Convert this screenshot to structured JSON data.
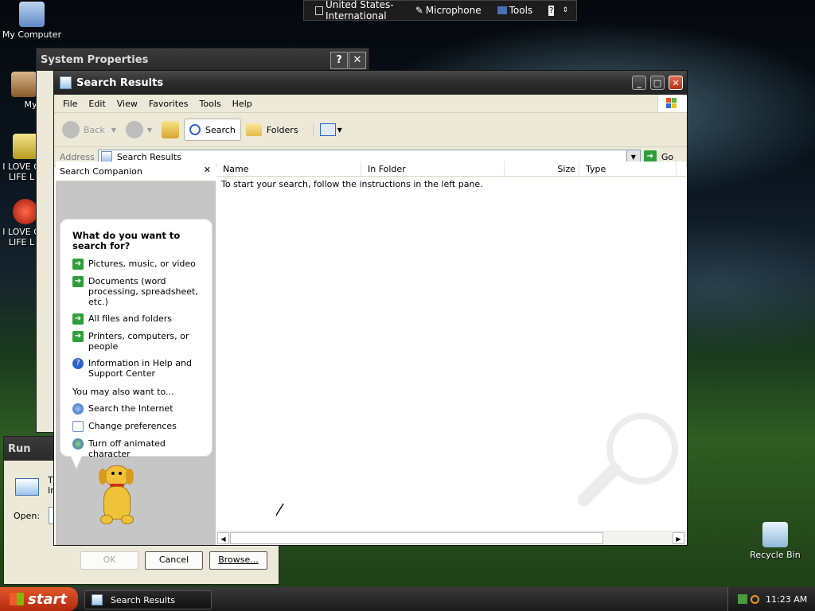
{
  "desktop": {
    "icons": [
      {
        "label": "My Computer"
      },
      {
        "label": "MyPa"
      },
      {
        "label": "I LOVE G LIFE L"
      },
      {
        "label": "I LOVE G LIFE L"
      },
      {
        "label": "Recycle Bin"
      }
    ]
  },
  "language_bar": {
    "language": "United States-International",
    "microphone": "Microphone",
    "tools": "Tools",
    "help": "?"
  },
  "system_properties": {
    "title": "System Properties",
    "help_btn": "?",
    "close_btn": "✕"
  },
  "run_dialog": {
    "title": "Run",
    "partial_text_1": "T",
    "partial_text_2": "In",
    "open_label": "Open:",
    "ok": "OK",
    "cancel": "Cancel",
    "browse": "Browse..."
  },
  "window": {
    "title": "Search Results",
    "menu": [
      "File",
      "Edit",
      "View",
      "Favorites",
      "Tools",
      "Help"
    ],
    "toolbar": {
      "back": "Back",
      "search": "Search",
      "folders": "Folders"
    },
    "address": {
      "label": "Address",
      "value": "Search Results",
      "go": "Go"
    },
    "companion": {
      "title": "Search Companion",
      "close": "✕",
      "question": "What do you want to search for?",
      "options": [
        "Pictures, music, or video",
        "Documents (word processing, spreadsheet, etc.)",
        "All files and folders",
        "Printers, computers, or people",
        "Information in Help and Support Center"
      ],
      "also_label": "You may also want to...",
      "also_options": [
        "Search the Internet",
        "Change preferences",
        "Turn off animated character"
      ]
    },
    "columns": [
      "Name",
      "In Folder",
      "Size",
      "Type"
    ],
    "message": "To start your search, follow the instructions in the left pane."
  },
  "taskbar": {
    "start": "start",
    "task_item": "Search Results",
    "clock": "11:23 AM"
  }
}
